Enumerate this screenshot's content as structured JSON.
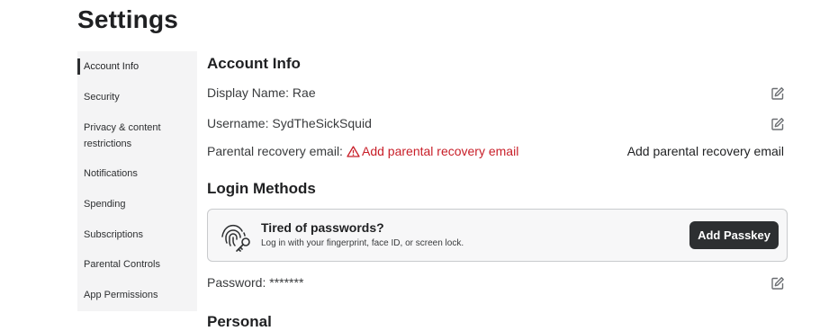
{
  "page": {
    "title": "Settings"
  },
  "sidebar": {
    "items": [
      {
        "label": "Account Info"
      },
      {
        "label": "Security"
      },
      {
        "label": "Privacy & content restrictions"
      },
      {
        "label": "Notifications"
      },
      {
        "label": "Spending"
      },
      {
        "label": "Subscriptions"
      },
      {
        "label": "Parental Controls"
      },
      {
        "label": "App Permissions"
      }
    ],
    "active_index": 0
  },
  "account_info": {
    "title": "Account Info",
    "display_name": "Display Name: Rae",
    "username": "Username: SydTheSickSquid",
    "parental_label": "Parental recovery email:",
    "parental_warning": "Add parental recovery email",
    "parental_action": "Add parental recovery email"
  },
  "login_methods": {
    "title": "Login Methods",
    "passkey_title": "Tired of passwords?",
    "passkey_subtitle": "Log in with your fingerprint, face ID, or screen lock.",
    "passkey_button": "Add Passkey",
    "password": "Password: *******"
  },
  "personal": {
    "title": "Personal"
  },
  "icons": {
    "edit": "edit-pencil-icon",
    "warning": "warning-triangle-icon",
    "passkey": "fingerprint-key-icon"
  },
  "colors": {
    "text": "#393b3d",
    "heading": "#1f2022",
    "warning": "#c81e28",
    "button_bg": "#2d2f31",
    "sidebar_bg": "#f4f4f5",
    "card_bg": "#f7f7f8"
  }
}
